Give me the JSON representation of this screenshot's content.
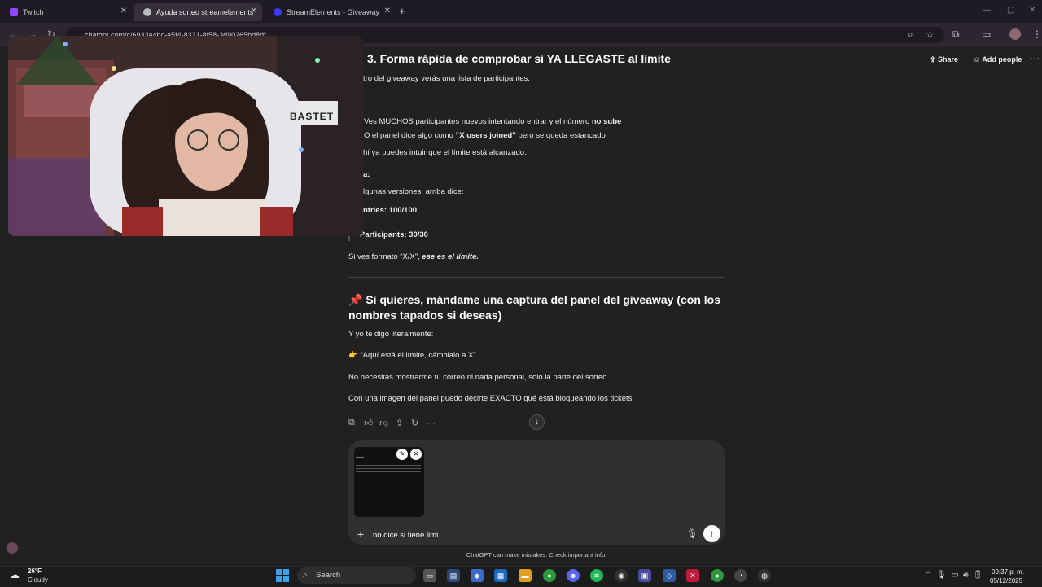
{
  "browser": {
    "tabs": [
      {
        "label": "Twitch",
        "color": "#9146ff"
      },
      {
        "label": "Ayuda sorteo streamelements",
        "color": "#cfcfcf"
      },
      {
        "label": "StreamElements - Giveaway",
        "color": "#3b3bff"
      }
    ],
    "url": "chatgpt.com/c/6933a4bc-a5f4-8331-8f58-3d90265bd8df"
  },
  "chat": {
    "title": "3. Forma rápida de comprobar si YA LLEGASTE al límite",
    "share_label": "Share",
    "add_people_label": "Add people",
    "lines": {
      "l1": "tro del giveaway verás una lista de participantes.",
      "l2a": "Ves MUCHOS participantes nuevos intentando entrar y el número ",
      "l2b": "no sube",
      "l3a": "O el panel dice algo como ",
      "l3b": "“X users joined”",
      "l3c": " pero se queda estancado",
      "l4": "hí ya puedes intuir que el límite está alcanzado.",
      "l5": "a:",
      "l6": "lgunas versiones, arriba dice:",
      "l7": "ntries: 100/100",
      "l8": "Participants: 30/30",
      "l9a": "Si ves formato “X/X”, ",
      "l9b": "ese es el límite."
    },
    "heading2": "📌 Si quieres, mándame una captura del panel del giveaway (con los nombres tapados si deseas)",
    "p1": "Y yo te digo literalmente:",
    "p2": "👉 “Aquí está el límite, cámbialo a X”.",
    "p3": "No necesitas mostrarme tu correo ni nada personal, solo la parte del sorteo.",
    "p4": "Con una imagen del panel puedo decirte EXACTO qué está bloqueando los tickets.",
    "composer_value": "no dice si tiene limi",
    "disclaimer": "ChatGPT can make mistakes. Check important info."
  },
  "webcam": {
    "sign_text": "BASTET"
  },
  "taskbar": {
    "weather_temp": "26°F",
    "weather_desc": "Cloudy",
    "search_label": "Search",
    "time": "09:37 p. m.",
    "date": "05/12/2025"
  }
}
